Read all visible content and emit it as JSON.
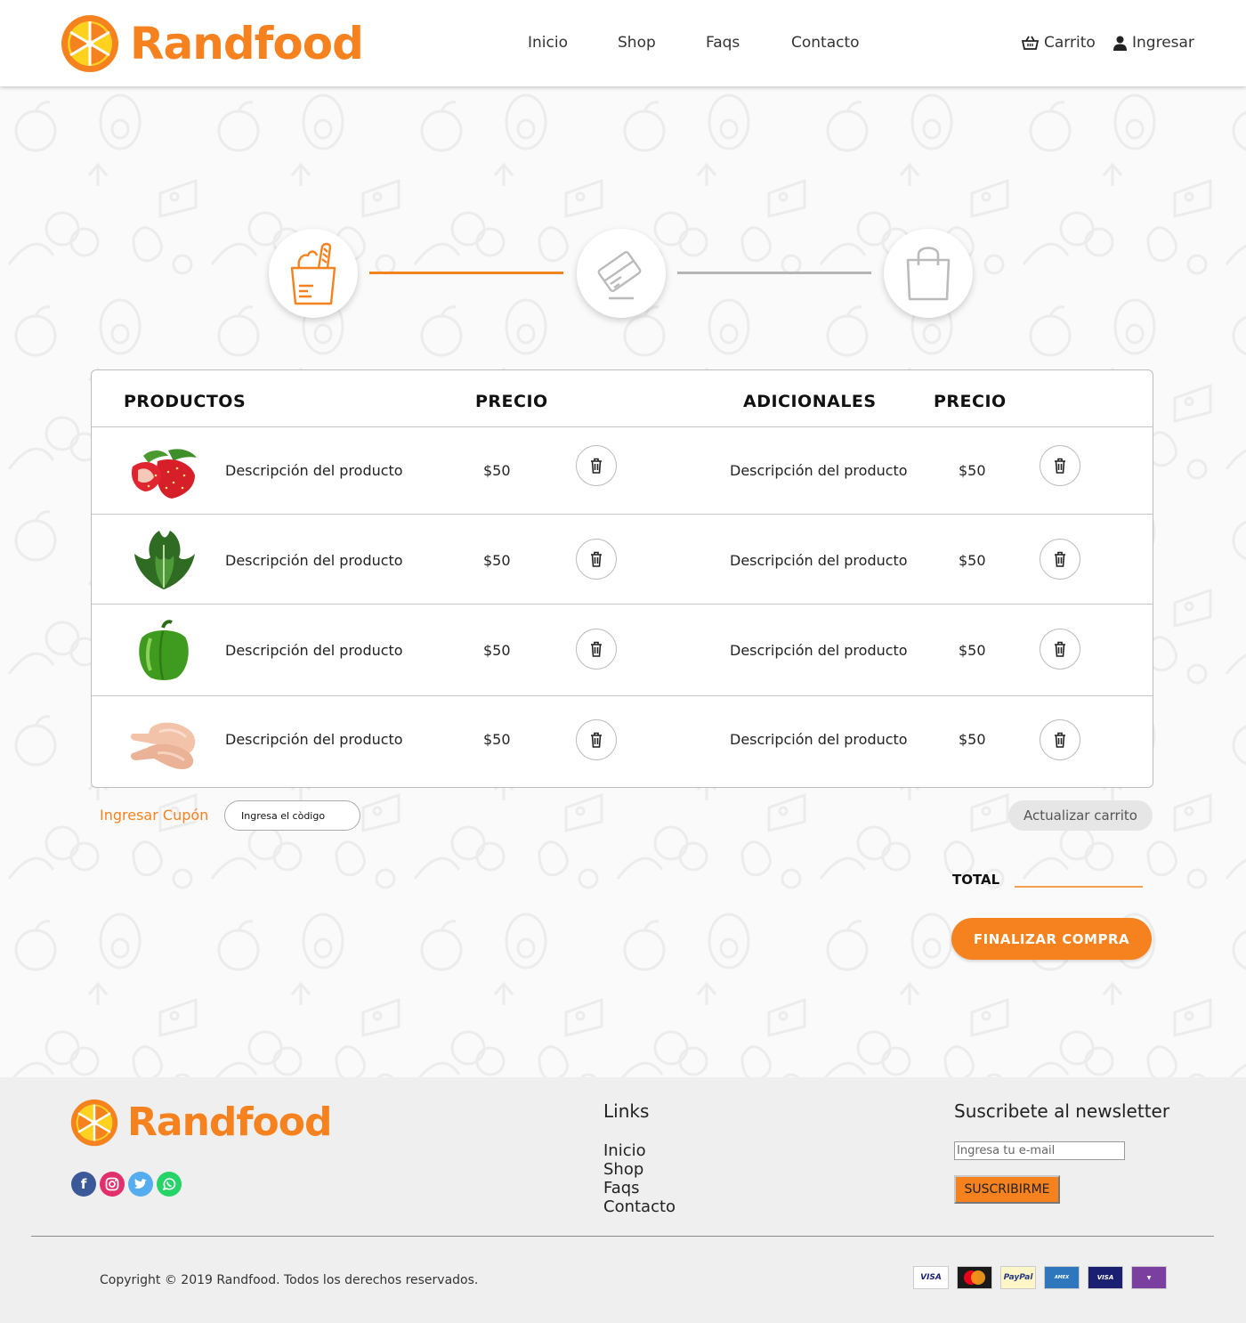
{
  "brand": {
    "name": "Randfood",
    "color": "#f5821f"
  },
  "nav": {
    "items": [
      "Inicio",
      "Shop",
      "Faqs",
      "Contacto"
    ]
  },
  "header_actions": {
    "cart_label": "Carrito",
    "cart_icon": "basket-icon",
    "login_label": "Ingresar",
    "login_icon": "user-icon"
  },
  "steps": [
    {
      "icon": "grocery-bag-icon",
      "state": "active"
    },
    {
      "icon": "credit-card-icon",
      "state": "inactive"
    },
    {
      "icon": "shopping-bag-icon",
      "state": "inactive"
    }
  ],
  "cart": {
    "headers": {
      "products": "PRODUCTOS",
      "price": "PRECIO",
      "extras": "ADICIONALES",
      "extras_price": "PRECIO"
    },
    "rows": [
      {
        "image": "strawberries",
        "product": "Descripción del producto",
        "price": "$50",
        "extra": "Descripción del producto",
        "extra_price": "$50"
      },
      {
        "image": "lettuce",
        "product": "Descripción del producto",
        "price": "$50",
        "extra": "Descripción del producto",
        "extra_price": "$50"
      },
      {
        "image": "green-pepper",
        "product": "Descripción del producto",
        "price": "$50",
        "extra": "Descripción del producto",
        "extra_price": "$50"
      },
      {
        "image": "chicken-legs",
        "product": "Descripción del producto",
        "price": "$50",
        "extra": "Descripción del producto",
        "extra_price": "$50"
      }
    ]
  },
  "coupon": {
    "label": "Ingresar Cupón",
    "placeholder": "Ingresa el còdigo"
  },
  "update_cart_label": "Actualizar carrito",
  "total": {
    "label": "TOTAL",
    "value": ""
  },
  "checkout_label": "FINALIZAR COMPRA",
  "footer": {
    "links_title": "Links",
    "links": [
      "Inicio",
      "Shop",
      "Faqs",
      "Contacto"
    ],
    "newsletter_title": "Suscribete al newsletter",
    "newsletter_placeholder": "Ingresa tu e-mail",
    "newsletter_button": "SUSCRIBIRME",
    "social": [
      "facebook-icon",
      "instagram-icon",
      "twitter-icon",
      "whatsapp-icon"
    ],
    "copyright": "Copyright © 2019 Randfood. Todos los derechos reservados.",
    "payments": [
      "VISA",
      "MasterCard",
      "PayPal",
      "American Express",
      "Visa Electron",
      "Laser"
    ]
  }
}
